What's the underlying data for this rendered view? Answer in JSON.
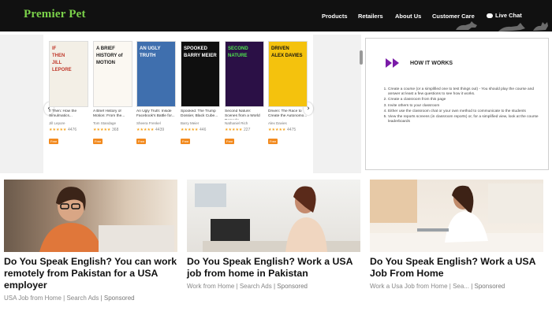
{
  "header": {
    "logo": "Premier Pet",
    "nav": [
      "Products",
      "Retailers",
      "About Us",
      "Customer Care",
      "Live Chat"
    ]
  },
  "colors": {
    "header_bg": "#111111",
    "logo": "#7bd24a",
    "free_badge": "#f28a1e",
    "how_icon": "#7a1ba8"
  },
  "books": [
    {
      "cover_lines": [
        "IF",
        "THEN",
        "JILL",
        "LEPORE"
      ],
      "title": "If Then: How the Simulmatics...",
      "author": "Jill Lepore",
      "rating_count": "4476",
      "badge": "Free",
      "cover_bg": "#f3efe6",
      "cover_fg": "#c0392b"
    },
    {
      "cover_lines": [
        "A BRIEF",
        "HISTORY of",
        "MOTION"
      ],
      "title": "A Brief History of Motion: From the...",
      "author": "Tom Standage",
      "rating_count": "368",
      "badge": "Free",
      "cover_bg": "#fbf8f2",
      "cover_fg": "#1a1a1a"
    },
    {
      "cover_lines": [
        "AN UGLY",
        "TRUTH"
      ],
      "title": "An Ugly Truth: Inside Facebook's Battle for...",
      "author": "Sheera Frenkel",
      "rating_count": "4439",
      "badge": "Free",
      "cover_bg": "#3f6fae",
      "cover_fg": "#ffffff"
    },
    {
      "cover_lines": [
        "SPOOKED",
        "BARRY MEIER"
      ],
      "title": "Spooked: The Trump Dossier, Black Cube...",
      "author": "Barry Meier",
      "rating_count": "446",
      "badge": "Free",
      "cover_bg": "#0f0f0f",
      "cover_fg": "#ffffff"
    },
    {
      "cover_lines": [
        "SECOND",
        "NATURE"
      ],
      "title": "Second Nature: Scenes from a World Remade",
      "author": "Nathaniel Rich",
      "rating_count": "227",
      "badge": "Free",
      "cover_bg": "#2b1046",
      "cover_fg": "#4ee44e"
    },
    {
      "cover_lines": [
        "DRIVEN",
        "ALEX DAVIES"
      ],
      "title": "Driven: The Race to Create the Autonomo...",
      "author": "Alex Davies",
      "rating_count": "4475",
      "badge": "Free",
      "cover_bg": "#f4c20d",
      "cover_fg": "#111111"
    }
  ],
  "carousel": {
    "prev": "‹",
    "next": "›"
  },
  "how_it_works": {
    "title": "HOW IT WORKS",
    "steps": [
      "Create a course (or a simplified one to test things out) - You should play the course and answer at least a few questions to see how it works.",
      "Create a classroom from this page",
      "Invite others to your classroom",
      "Either use the classroom chat or your own method to communicate to the students",
      "View the reports screens (in classroom reports) or, for a simplified view, look at the course leaderboards"
    ]
  },
  "ads": [
    {
      "title": "Do You Speak English? You can work remotely from Pakistan for a USA employer",
      "source": "USA Job from Home | Search Ads",
      "sponsored": "| Sponsored"
    },
    {
      "title": "Do You Speak English? Work a USA job from home in Pakistan",
      "source": "Work from Home | Search Ads",
      "sponsored": "| Sponsored"
    },
    {
      "title": "Do You Speak English? Work a USA Job From Home",
      "source": "Work a Usa Job from Home | Sea...",
      "sponsored": "| Sponsored"
    }
  ]
}
